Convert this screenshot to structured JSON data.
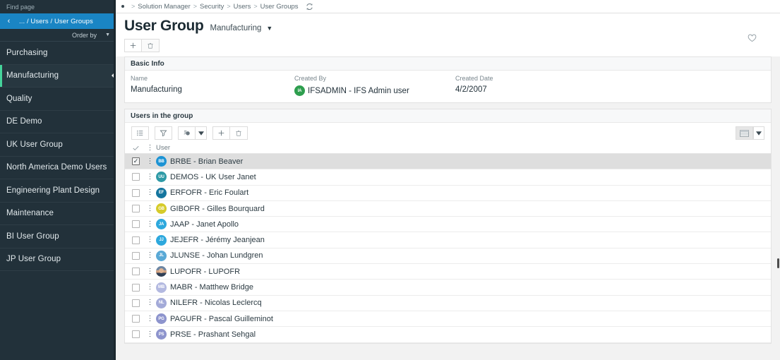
{
  "sidebar": {
    "find_placeholder": "Find page",
    "back_icon": "chevron-left-icon",
    "breadcrumb": "... / Users / User Groups",
    "order_by_label": "Order by",
    "order_caret": "▼",
    "items": [
      {
        "label": "Purchasing",
        "active": false
      },
      {
        "label": "Manufacturing",
        "active": true
      },
      {
        "label": "Quality",
        "active": false
      },
      {
        "label": "DE Demo",
        "active": false
      },
      {
        "label": "UK User Group",
        "active": false
      },
      {
        "label": "North America Demo Users",
        "active": false
      },
      {
        "label": "Engineering Plant Design",
        "active": false
      },
      {
        "label": "Maintenance",
        "active": false
      },
      {
        "label": "BI User Group",
        "active": false
      },
      {
        "label": "JP User Group",
        "active": false
      }
    ]
  },
  "topbar": {
    "breadcrumb": [
      "Solution Manager",
      "Security",
      "Users",
      "User Groups"
    ],
    "separator": ">",
    "refresh_icon": "refresh-icon"
  },
  "header": {
    "title": "User Group",
    "subtitle": "Manufacturing",
    "subtitle_caret": "▼",
    "new_icon": "plus-icon",
    "delete_icon": "trash-icon",
    "favorite_icon": "heart-outline-icon"
  },
  "basic_info": {
    "section_title": "Basic Info",
    "fields": [
      {
        "label": "Name",
        "value": "Manufacturing"
      },
      {
        "label": "Created By",
        "value": "IFSADMIN - IFS Admin user",
        "avatar": "IA",
        "avatar_color": "#2e9e4e"
      },
      {
        "label": "Created Date",
        "value": "4/2/2007"
      }
    ]
  },
  "users_section": {
    "section_title": "Users in the group",
    "toolbar": [
      {
        "name": "list-view-icon",
        "glyph": "list"
      },
      {
        "name": "filter-icon",
        "glyph": "funnel"
      },
      {
        "name": "export-icon",
        "glyph": "export"
      },
      {
        "name": "export-dropdown-caret",
        "glyph": "caret"
      },
      {
        "name": "add-icon",
        "glyph": "plus"
      },
      {
        "name": "delete-icon",
        "glyph": "trash"
      }
    ],
    "right_toolbar": [
      {
        "name": "table-view-icon",
        "glyph": "table",
        "selected": true
      },
      {
        "name": "view-dropdown-caret",
        "glyph": "caret",
        "selected": false
      }
    ],
    "columns": {
      "select_all_icon": "check-icon",
      "row_menu_icon": "vertical-dots-icon",
      "user_header": "User"
    },
    "rows": [
      {
        "initials": "BB",
        "color": "#1c93d4",
        "label": "BRBE - Brian Beaver",
        "selected": true,
        "photo": false
      },
      {
        "initials": "UU",
        "color": "#2e9aa6",
        "label": "DEMOS - UK User Janet",
        "selected": false,
        "photo": false
      },
      {
        "initials": "EF",
        "color": "#14759e",
        "label": "ERFOFR - Eric Foulart",
        "selected": false,
        "photo": false
      },
      {
        "initials": "GB",
        "color": "#d6cb2a",
        "label": "GIBOFR - Gilles Bourquard",
        "selected": false,
        "photo": false
      },
      {
        "initials": "JA",
        "color": "#2da8dd",
        "label": "JAAP - Janet Apollo",
        "selected": false,
        "photo": false
      },
      {
        "initials": "JJ",
        "color": "#2da8dd",
        "label": "JEJEFR - Jérémy Jeanjean",
        "selected": false,
        "photo": false
      },
      {
        "initials": "JL",
        "color": "#5aa9d6",
        "label": "JLUNSE - Johan Lundgren",
        "selected": false,
        "photo": false
      },
      {
        "initials": "",
        "color": "#8a9bb0",
        "label": "LUPOFR - LUPOFR",
        "selected": false,
        "photo": true
      },
      {
        "initials": "MB",
        "color": "#b3b9e0",
        "label": "MABR - Matthew Bridge",
        "selected": false,
        "photo": false
      },
      {
        "initials": "NL",
        "color": "#a3aad8",
        "label": "NILEFR - Nicolas Leclercq",
        "selected": false,
        "photo": false
      },
      {
        "initials": "PG",
        "color": "#8d94cd",
        "label": "PAGUFR - Pascal Guilleminot",
        "selected": false,
        "photo": false
      },
      {
        "initials": "PS",
        "color": "#8d94cd",
        "label": "PRSE - Prashant Sehgal",
        "selected": false,
        "photo": false
      }
    ]
  },
  "colors": {
    "sidebar_bg": "#22313a",
    "sidebar_active_marker": "#45d39b",
    "crumb_bg": "#1a85c4",
    "selected_row": "#dedede"
  }
}
